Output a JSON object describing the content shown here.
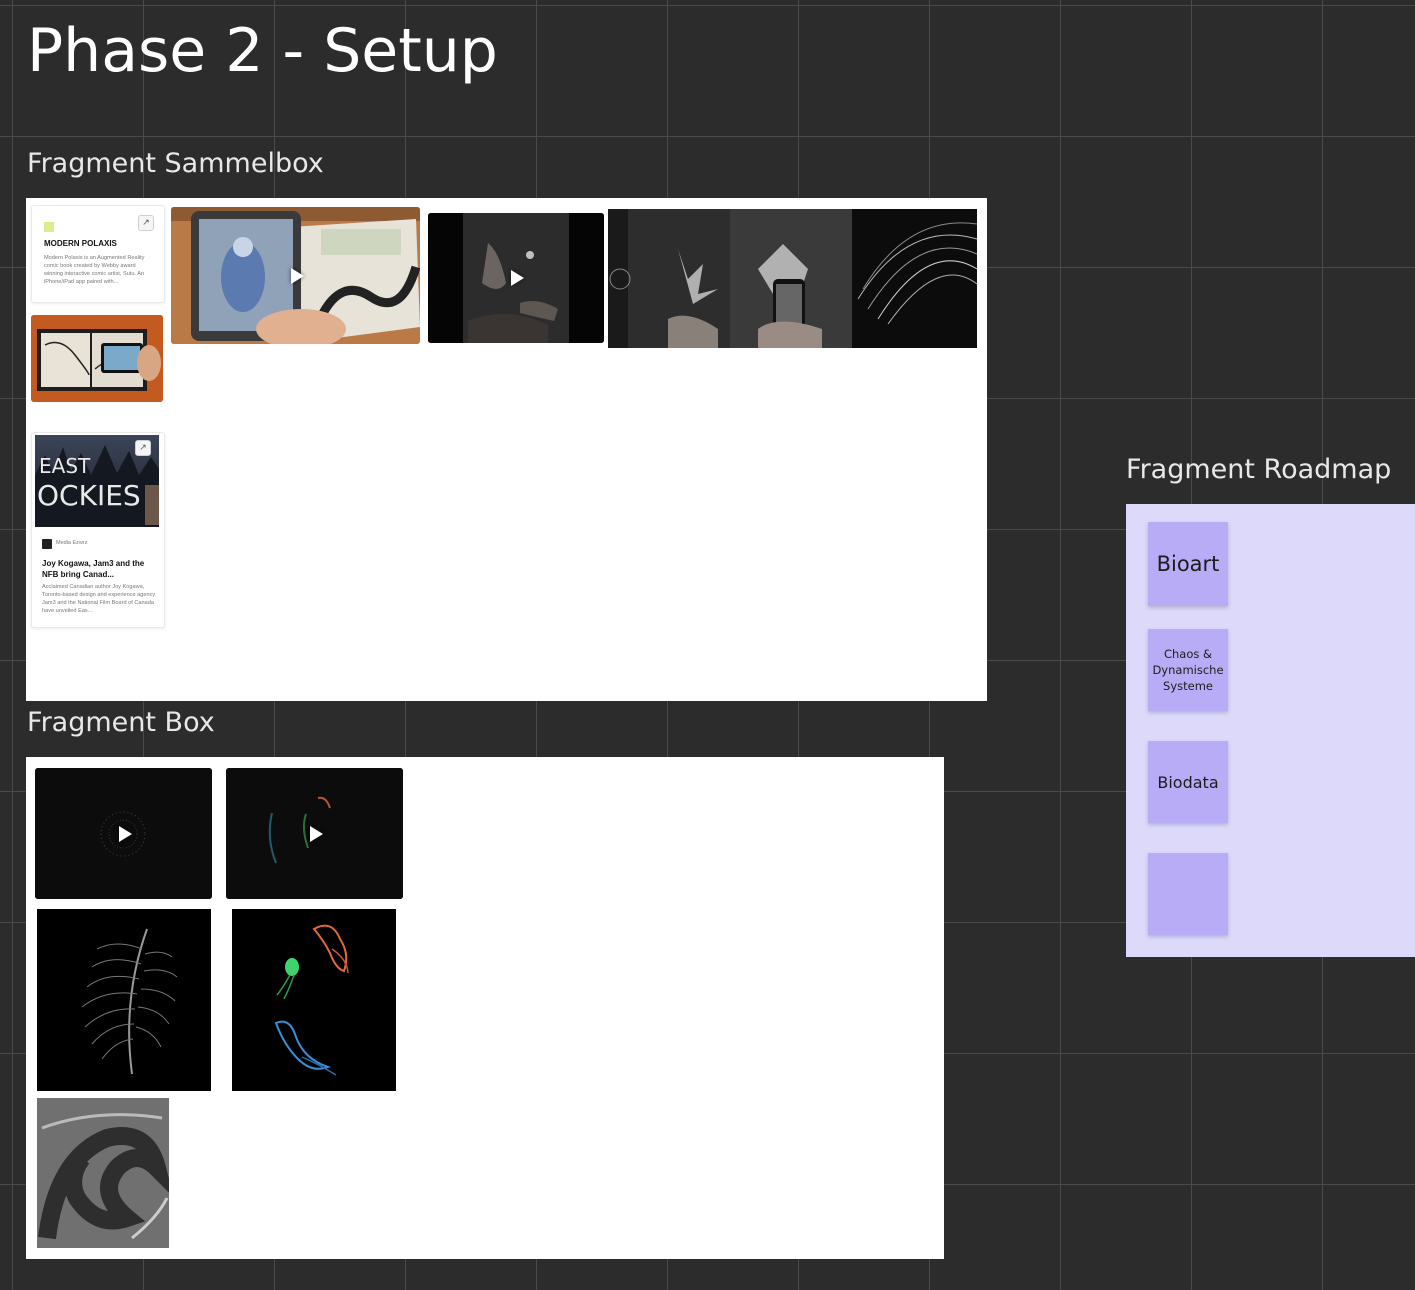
{
  "board": {
    "title": "Phase 2 - Setup"
  },
  "sammelbox": {
    "title": "Fragment Sammelbox",
    "link_card_1": {
      "title": "MODERN POLAXIS",
      "description": "Modern Polaxis is an Augmented Reality comic book created by Webby award winning interactive comic artist, Sutu. An iPhone/iPad app paired with..."
    },
    "link_card_2": {
      "thumbnail_text": "EAST OF THE ROCKIES",
      "source": "Media Ezwrz",
      "title": "Joy Kogawa, Jam3 and the NFB bring Canad...",
      "description": "Acclaimed Canadian author Joy Kogawa, Toronto-based design and experience agency Jam3 and the National Film Board of Canada have unveiled Eas..."
    }
  },
  "box": {
    "title": "Fragment Box"
  },
  "roadmap": {
    "title": "Fragment Roadmap",
    "notes": [
      "Bioart",
      "Chaos & Dynamische Systeme",
      "Biodata",
      ""
    ]
  },
  "colors": {
    "canvas": "#2c2c2c",
    "grid": "#4a4a4a",
    "roadmap_frame": "#dcd9fb",
    "sticky_note": "#b9acf7"
  }
}
